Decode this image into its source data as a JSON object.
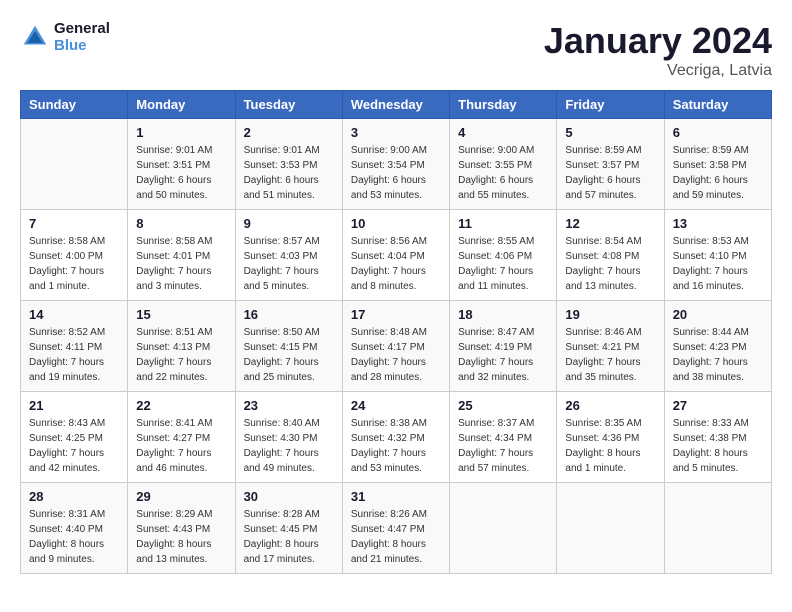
{
  "header": {
    "logo_line1": "General",
    "logo_line2": "Blue",
    "title": "January 2024",
    "location": "Vecriga, Latvia"
  },
  "weekdays": [
    "Sunday",
    "Monday",
    "Tuesday",
    "Wednesday",
    "Thursday",
    "Friday",
    "Saturday"
  ],
  "weeks": [
    [
      {
        "day": "",
        "sunrise": "",
        "sunset": "",
        "daylight": ""
      },
      {
        "day": "1",
        "sunrise": "Sunrise: 9:01 AM",
        "sunset": "Sunset: 3:51 PM",
        "daylight": "Daylight: 6 hours and 50 minutes."
      },
      {
        "day": "2",
        "sunrise": "Sunrise: 9:01 AM",
        "sunset": "Sunset: 3:53 PM",
        "daylight": "Daylight: 6 hours and 51 minutes."
      },
      {
        "day": "3",
        "sunrise": "Sunrise: 9:00 AM",
        "sunset": "Sunset: 3:54 PM",
        "daylight": "Daylight: 6 hours and 53 minutes."
      },
      {
        "day": "4",
        "sunrise": "Sunrise: 9:00 AM",
        "sunset": "Sunset: 3:55 PM",
        "daylight": "Daylight: 6 hours and 55 minutes."
      },
      {
        "day": "5",
        "sunrise": "Sunrise: 8:59 AM",
        "sunset": "Sunset: 3:57 PM",
        "daylight": "Daylight: 6 hours and 57 minutes."
      },
      {
        "day": "6",
        "sunrise": "Sunrise: 8:59 AM",
        "sunset": "Sunset: 3:58 PM",
        "daylight": "Daylight: 6 hours and 59 minutes."
      }
    ],
    [
      {
        "day": "7",
        "sunrise": "Sunrise: 8:58 AM",
        "sunset": "Sunset: 4:00 PM",
        "daylight": "Daylight: 7 hours and 1 minute."
      },
      {
        "day": "8",
        "sunrise": "Sunrise: 8:58 AM",
        "sunset": "Sunset: 4:01 PM",
        "daylight": "Daylight: 7 hours and 3 minutes."
      },
      {
        "day": "9",
        "sunrise": "Sunrise: 8:57 AM",
        "sunset": "Sunset: 4:03 PM",
        "daylight": "Daylight: 7 hours and 5 minutes."
      },
      {
        "day": "10",
        "sunrise": "Sunrise: 8:56 AM",
        "sunset": "Sunset: 4:04 PM",
        "daylight": "Daylight: 7 hours and 8 minutes."
      },
      {
        "day": "11",
        "sunrise": "Sunrise: 8:55 AM",
        "sunset": "Sunset: 4:06 PM",
        "daylight": "Daylight: 7 hours and 11 minutes."
      },
      {
        "day": "12",
        "sunrise": "Sunrise: 8:54 AM",
        "sunset": "Sunset: 4:08 PM",
        "daylight": "Daylight: 7 hours and 13 minutes."
      },
      {
        "day": "13",
        "sunrise": "Sunrise: 8:53 AM",
        "sunset": "Sunset: 4:10 PM",
        "daylight": "Daylight: 7 hours and 16 minutes."
      }
    ],
    [
      {
        "day": "14",
        "sunrise": "Sunrise: 8:52 AM",
        "sunset": "Sunset: 4:11 PM",
        "daylight": "Daylight: 7 hours and 19 minutes."
      },
      {
        "day": "15",
        "sunrise": "Sunrise: 8:51 AM",
        "sunset": "Sunset: 4:13 PM",
        "daylight": "Daylight: 7 hours and 22 minutes."
      },
      {
        "day": "16",
        "sunrise": "Sunrise: 8:50 AM",
        "sunset": "Sunset: 4:15 PM",
        "daylight": "Daylight: 7 hours and 25 minutes."
      },
      {
        "day": "17",
        "sunrise": "Sunrise: 8:48 AM",
        "sunset": "Sunset: 4:17 PM",
        "daylight": "Daylight: 7 hours and 28 minutes."
      },
      {
        "day": "18",
        "sunrise": "Sunrise: 8:47 AM",
        "sunset": "Sunset: 4:19 PM",
        "daylight": "Daylight: 7 hours and 32 minutes."
      },
      {
        "day": "19",
        "sunrise": "Sunrise: 8:46 AM",
        "sunset": "Sunset: 4:21 PM",
        "daylight": "Daylight: 7 hours and 35 minutes."
      },
      {
        "day": "20",
        "sunrise": "Sunrise: 8:44 AM",
        "sunset": "Sunset: 4:23 PM",
        "daylight": "Daylight: 7 hours and 38 minutes."
      }
    ],
    [
      {
        "day": "21",
        "sunrise": "Sunrise: 8:43 AM",
        "sunset": "Sunset: 4:25 PM",
        "daylight": "Daylight: 7 hours and 42 minutes."
      },
      {
        "day": "22",
        "sunrise": "Sunrise: 8:41 AM",
        "sunset": "Sunset: 4:27 PM",
        "daylight": "Daylight: 7 hours and 46 minutes."
      },
      {
        "day": "23",
        "sunrise": "Sunrise: 8:40 AM",
        "sunset": "Sunset: 4:30 PM",
        "daylight": "Daylight: 7 hours and 49 minutes."
      },
      {
        "day": "24",
        "sunrise": "Sunrise: 8:38 AM",
        "sunset": "Sunset: 4:32 PM",
        "daylight": "Daylight: 7 hours and 53 minutes."
      },
      {
        "day": "25",
        "sunrise": "Sunrise: 8:37 AM",
        "sunset": "Sunset: 4:34 PM",
        "daylight": "Daylight: 7 hours and 57 minutes."
      },
      {
        "day": "26",
        "sunrise": "Sunrise: 8:35 AM",
        "sunset": "Sunset: 4:36 PM",
        "daylight": "Daylight: 8 hours and 1 minute."
      },
      {
        "day": "27",
        "sunrise": "Sunrise: 8:33 AM",
        "sunset": "Sunset: 4:38 PM",
        "daylight": "Daylight: 8 hours and 5 minutes."
      }
    ],
    [
      {
        "day": "28",
        "sunrise": "Sunrise: 8:31 AM",
        "sunset": "Sunset: 4:40 PM",
        "daylight": "Daylight: 8 hours and 9 minutes."
      },
      {
        "day": "29",
        "sunrise": "Sunrise: 8:29 AM",
        "sunset": "Sunset: 4:43 PM",
        "daylight": "Daylight: 8 hours and 13 minutes."
      },
      {
        "day": "30",
        "sunrise": "Sunrise: 8:28 AM",
        "sunset": "Sunset: 4:45 PM",
        "daylight": "Daylight: 8 hours and 17 minutes."
      },
      {
        "day": "31",
        "sunrise": "Sunrise: 8:26 AM",
        "sunset": "Sunset: 4:47 PM",
        "daylight": "Daylight: 8 hours and 21 minutes."
      },
      {
        "day": "",
        "sunrise": "",
        "sunset": "",
        "daylight": ""
      },
      {
        "day": "",
        "sunrise": "",
        "sunset": "",
        "daylight": ""
      },
      {
        "day": "",
        "sunrise": "",
        "sunset": "",
        "daylight": ""
      }
    ]
  ]
}
